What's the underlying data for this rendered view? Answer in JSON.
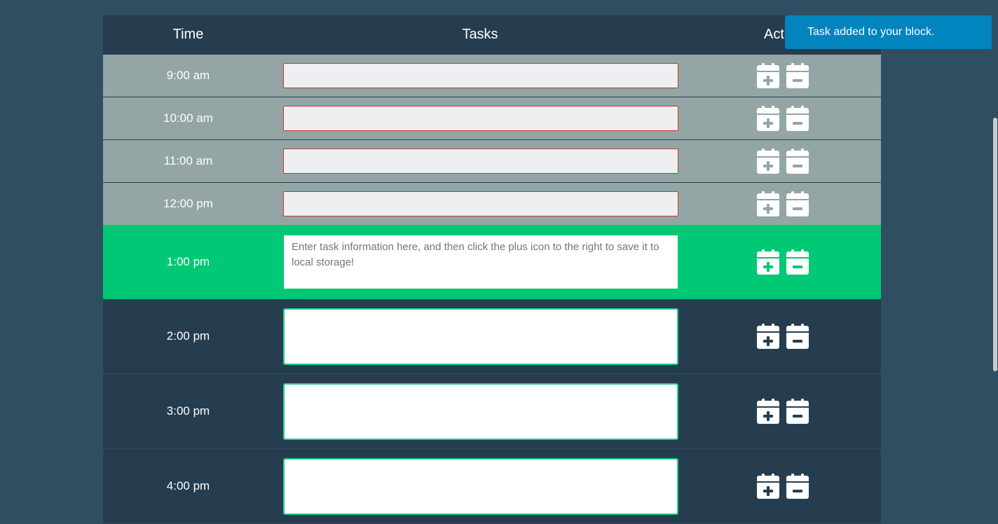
{
  "header": {
    "time_label": "Time",
    "tasks_label": "Tasks",
    "action_label": "Action"
  },
  "toast": {
    "message": "Task added to your block."
  },
  "colors": {
    "past": "#93a6a5",
    "present": "#00c875",
    "future": "#263d4f",
    "toast": "#0284bf"
  },
  "icons": {
    "save": "calendar-plus-icon",
    "delete": "calendar-minus-icon"
  },
  "hours": [
    {
      "time": "9:00 am",
      "state": "past",
      "task": "",
      "placeholder": ""
    },
    {
      "time": "10:00 am",
      "state": "past",
      "task": "",
      "placeholder": ""
    },
    {
      "time": "11:00 am",
      "state": "past",
      "task": "",
      "placeholder": ""
    },
    {
      "time": "12:00 pm",
      "state": "past",
      "task": "",
      "placeholder": ""
    },
    {
      "time": "1:00 pm",
      "state": "present",
      "task": "",
      "placeholder": "Enter task information here, and then click the plus icon to the right to save it to local storage!"
    },
    {
      "time": "2:00 pm",
      "state": "future",
      "task": "",
      "placeholder": ""
    },
    {
      "time": "3:00 pm",
      "state": "future",
      "task": "",
      "placeholder": ""
    },
    {
      "time": "4:00 pm",
      "state": "future",
      "task": "",
      "placeholder": ""
    }
  ]
}
